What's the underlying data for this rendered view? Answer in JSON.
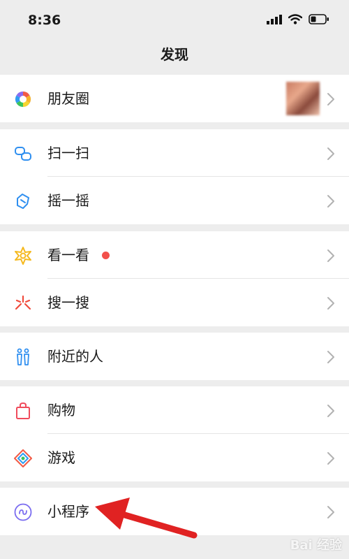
{
  "status": {
    "time": "8:36"
  },
  "header": {
    "title": "发现"
  },
  "menu": {
    "moments": "朋友圈",
    "scan": "扫一扫",
    "shake": "摇一摇",
    "top_stories": "看一看",
    "search": "搜一搜",
    "people_nearby": "附近的人",
    "shopping": "购物",
    "games": "游戏",
    "mini_programs": "小程序"
  },
  "colors": {
    "background": "#ededed",
    "cell": "#ffffff",
    "badge_red": "#f2504b",
    "annotation_arrow": "#e02222"
  },
  "watermark": "Bai 经验"
}
